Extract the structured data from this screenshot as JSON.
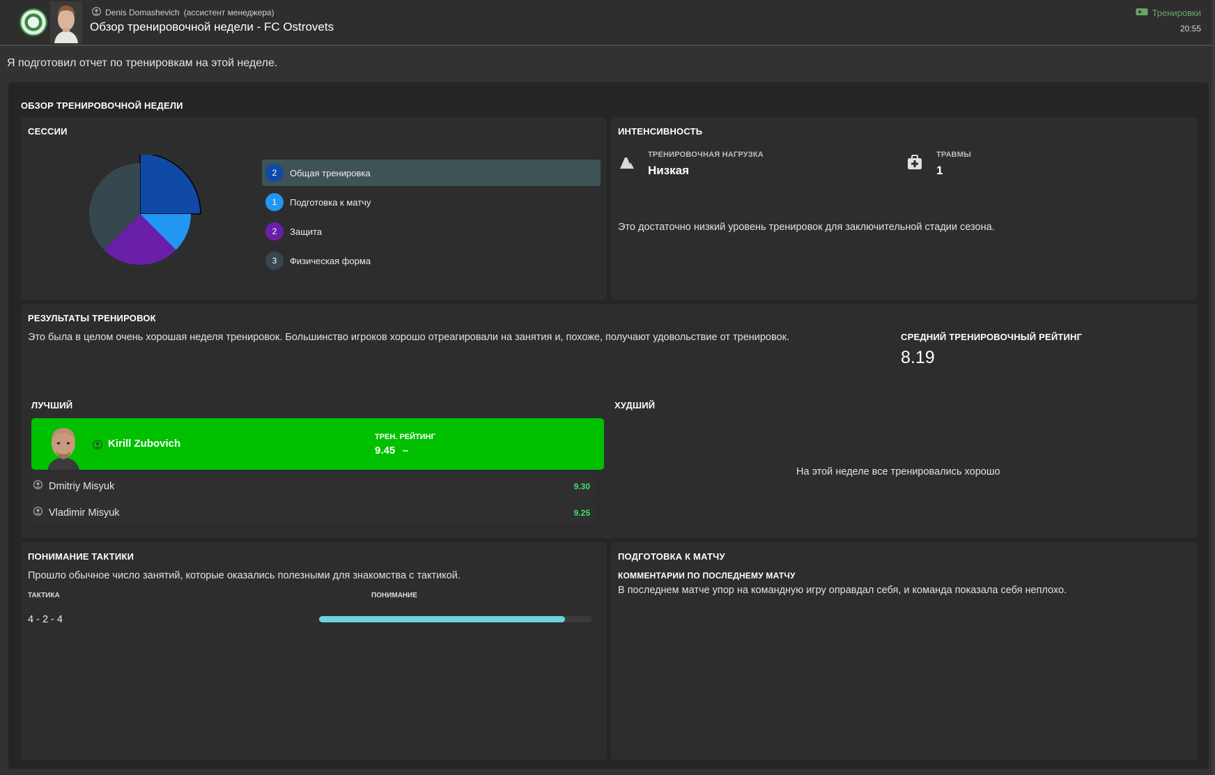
{
  "header": {
    "sender_name": "Denis Domashevich",
    "sender_role": "(ассистент менеджера)",
    "title": "Обзор тренировочной недели - FC Ostrovets",
    "topic_tag": "Тренировки",
    "time": "20:55"
  },
  "intro": "Я подготовил отчет по тренировкам на этой неделе.",
  "main_title": "ОБЗОР ТРЕНИРОВОЧНОЙ НЕДЕЛИ",
  "sessions": {
    "title": "СЕССИИ",
    "items": [
      {
        "count": "2",
        "label": "Общая тренировка",
        "color": "#0f4aa6",
        "selected": true
      },
      {
        "count": "1",
        "label": "Подготовка к матчу",
        "color": "#2196f3",
        "selected": false
      },
      {
        "count": "2",
        "label": "Защита",
        "color": "#6a1fa8",
        "selected": false
      },
      {
        "count": "3",
        "label": "Физическая форма",
        "color": "#37474f",
        "selected": false
      }
    ]
  },
  "intensity": {
    "title": "ИНТЕНСИВНОСТЬ",
    "load_label": "ТРЕНИРОВОЧНАЯ НАГРУЗКА",
    "load_value": "Низкая",
    "injuries_label": "ТРАВМЫ",
    "injuries_value": "1",
    "comment": "Это достаточно низкий уровень тренировок для заключительной стадии сезона."
  },
  "results": {
    "title": "РЕЗУЛЬТАТЫ ТРЕНИРОВОК",
    "text": "Это была в целом очень хорошая неделя тренировок. Большинство игроков хорошо отреагировали на занятия и, похоже, получают удовольствие от тренировок.",
    "avg_label": "СРЕДНИЙ ТРЕНИРОВОЧНЫЙ РЕЙТИНГ",
    "avg_value": "8.19",
    "best_title": "ЛУЧШИЙ",
    "worst_title": "ХУДШИЙ",
    "best_player": {
      "name": "Kirill Zubovich",
      "rating_label": "ТРЕН. РЕЙТИНГ",
      "rating": "9.45",
      "trend": "–"
    },
    "others": [
      {
        "name": "Dmitriy Misyuk",
        "rating": "9.30"
      },
      {
        "name": "Vladimir Misyuk",
        "rating": "9.25"
      }
    ],
    "worst_text": "На этой неделе все тренировались хорошо"
  },
  "tactics": {
    "title": "ПОНИМАНИЕ ТАКТИКИ",
    "text": "Прошло обычное число занятий, которые оказались полезными для знакомства с тактикой.",
    "col_tactic": "ТАКТИКА",
    "col_understanding": "ПОНИМАНИЕ",
    "rows": [
      {
        "tactic": "4 - 2 - 4",
        "understanding": 0.9
      }
    ]
  },
  "match_prep": {
    "title": "ПОДГОТОВКА К МАТЧУ",
    "subtitle": "КОММЕНТАРИИ ПО ПОСЛЕДНЕМУ МАТЧУ",
    "text": "В последнем матче упор на командную игру оправдал себя, и команда показала себя неплохо."
  },
  "colors": {
    "best_row": "#00c000",
    "rating_green": "#3fe06a",
    "tactic_bar": "#6bd3df",
    "topic_tag": "#6aa56a"
  }
}
